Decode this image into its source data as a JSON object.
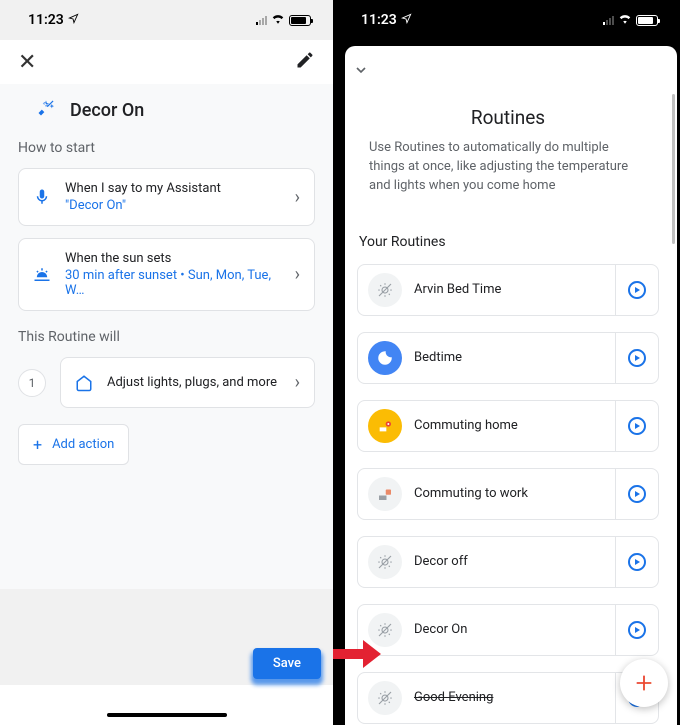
{
  "status": {
    "time": "11:23"
  },
  "left": {
    "title": "Decor On",
    "how_to_start": "How to start",
    "trigger_voice_title": "When I say to my Assistant",
    "trigger_voice_sub": "\"Decor On\"",
    "trigger_sun_title": "When the sun sets",
    "trigger_sun_sub": "30 min after sunset • Sun, Mon, Tue, W…",
    "routine_will": "This Routine will",
    "step1_num": "1",
    "step1_label": "Adjust lights, plugs, and more",
    "add_action": "Add action",
    "save": "Save"
  },
  "right": {
    "title": "Routines",
    "desc": "Use Routines to automatically do multiple things at once, like adjusting the temperature and lights when you come home",
    "your_routines": "Your Routines",
    "routines": [
      {
        "name": "Arvin Bed Time"
      },
      {
        "name": "Bedtime"
      },
      {
        "name": "Commuting home"
      },
      {
        "name": "Commuting to work"
      },
      {
        "name": "Decor off"
      },
      {
        "name": "Decor On"
      },
      {
        "name": "Good Evening"
      }
    ]
  }
}
